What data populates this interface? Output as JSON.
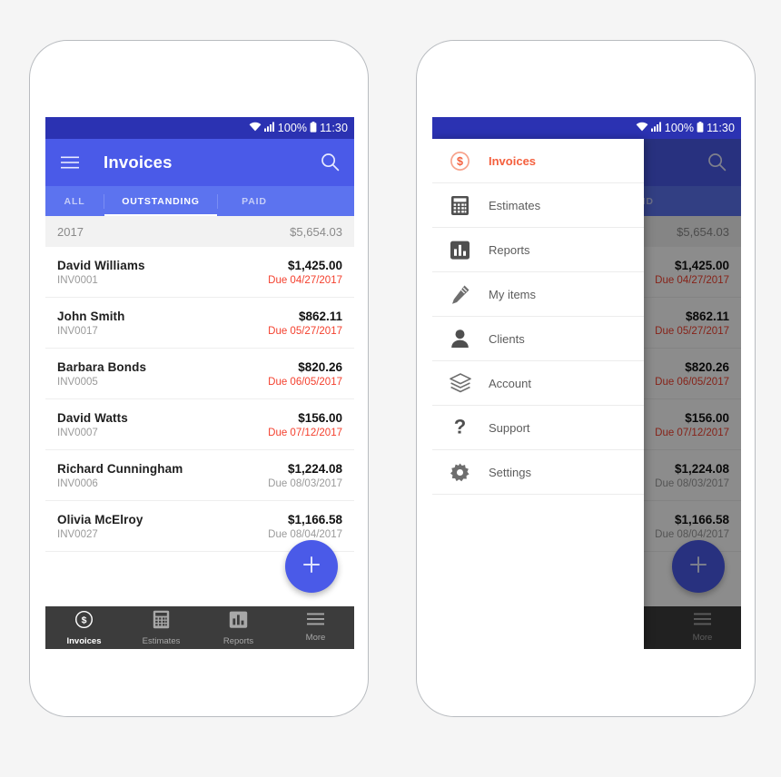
{
  "status_bar": {
    "battery": "100%",
    "time": "11:30",
    "wifi_icon": "wifi-icon",
    "signal_icon": "signal-icon",
    "battery_icon": "battery-icon"
  },
  "app_bar": {
    "title": "Invoices",
    "menu_icon": "hamburger-menu-icon",
    "back_icon": "back-arrow-icon",
    "search_icon": "search-icon"
  },
  "tabs": [
    {
      "label": "ALL",
      "active": false
    },
    {
      "label": "OUTSTANDING",
      "active": true
    },
    {
      "label": "PAID",
      "active": false
    }
  ],
  "year_header": {
    "year": "2017",
    "total": "$5,654.03"
  },
  "invoices": [
    {
      "name": "David Williams",
      "number": "INV0001",
      "amount": "$1,425.00",
      "due": "Due 04/27/2017",
      "overdue": true
    },
    {
      "name": "John Smith",
      "number": "INV0017",
      "amount": "$862.11",
      "due": "Due 05/27/2017",
      "overdue": true
    },
    {
      "name": "Barbara Bonds",
      "number": "INV0005",
      "amount": "$820.26",
      "due": "Due 06/05/2017",
      "overdue": true
    },
    {
      "name": "David Watts",
      "number": "INV0007",
      "amount": "$156.00",
      "due": "Due 07/12/2017",
      "overdue": true
    },
    {
      "name": "Richard Cunningham",
      "number": "INV0006",
      "amount": "$1,224.08",
      "due": "Due 08/03/2017",
      "overdue": false
    },
    {
      "name": "Olivia McElroy",
      "number": "INV0027",
      "amount": "$1,166.58",
      "due": "Due 08/04/2017",
      "overdue": false
    }
  ],
  "fab": {
    "icon": "plus-icon",
    "label": "+"
  },
  "bottom_nav": [
    {
      "label": "Invoices",
      "icon": "dollar-coin-icon",
      "active": true
    },
    {
      "label": "Estimates",
      "icon": "calculator-icon",
      "active": false
    },
    {
      "label": "Reports",
      "icon": "bar-chart-icon",
      "active": false
    },
    {
      "label": "More",
      "icon": "hamburger-menu-icon",
      "active": false
    }
  ],
  "drawer": {
    "items": [
      {
        "label": "Invoices",
        "icon": "dollar-coin-icon",
        "active": true
      },
      {
        "label": "Estimates",
        "icon": "calculator-icon",
        "active": false
      },
      {
        "label": "Reports",
        "icon": "bar-chart-icon",
        "active": false
      },
      {
        "label": "My items",
        "icon": "pencil-icon",
        "active": false
      },
      {
        "label": "Clients",
        "icon": "person-icon",
        "active": false
      },
      {
        "label": "Account",
        "icon": "layers-icon",
        "active": false
      },
      {
        "label": "Support",
        "icon": "question-mark-icon",
        "active": false
      },
      {
        "label": "Settings",
        "icon": "gear-icon",
        "active": false
      }
    ]
  },
  "colors": {
    "status_bar": "#2b32b2",
    "app_bar": "#4a5ae8",
    "tab_bar": "#5c73ef",
    "accent_orange": "#f4603e",
    "overdue_red": "#f4402e",
    "bottom_nav": "#3c3c3c",
    "page_background": "#f5f5f5"
  }
}
